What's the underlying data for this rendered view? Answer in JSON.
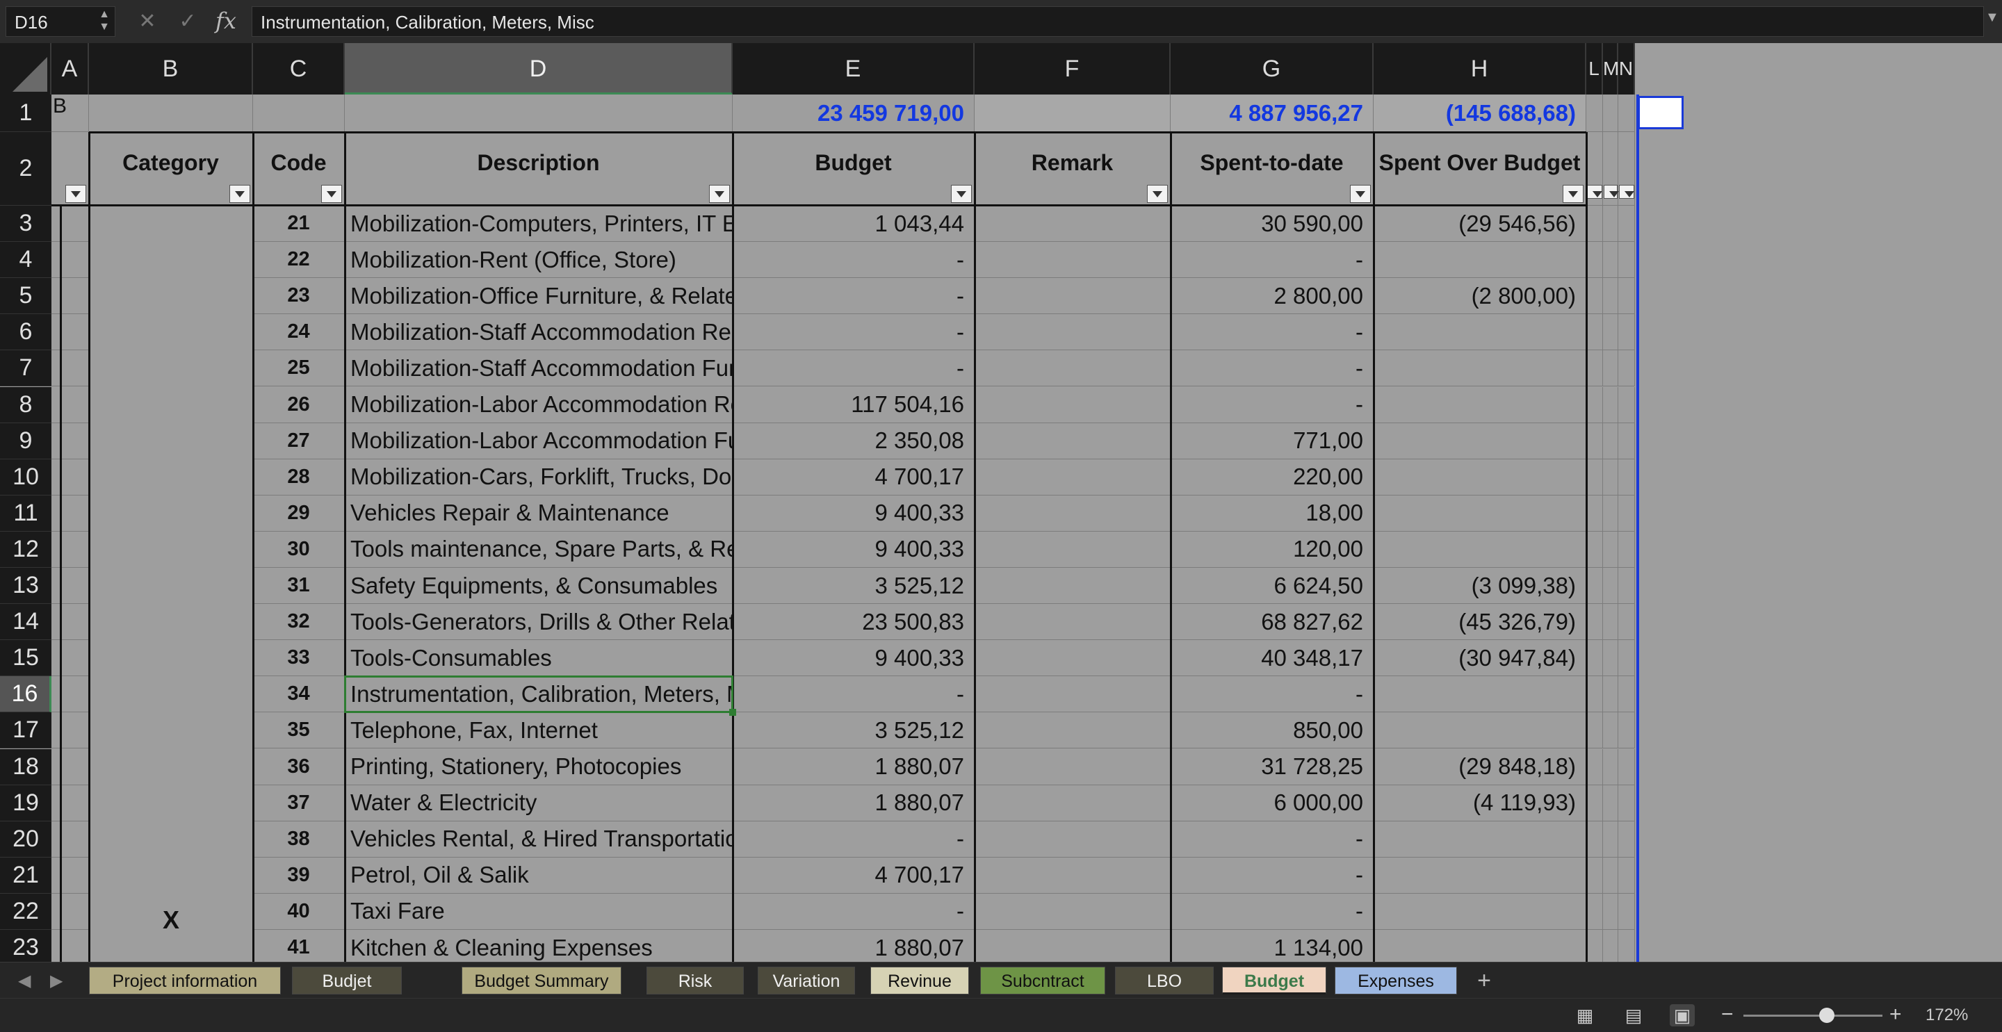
{
  "formula_bar": {
    "cell_ref": "D16",
    "cancel_icon": "✕",
    "confirm_icon": "✓",
    "fx_label": "fx",
    "content": "Instrumentation, Calibration, Meters, Misc"
  },
  "columns": [
    "A",
    "B",
    "C",
    "D",
    "E",
    "F",
    "G",
    "H",
    "L",
    "M",
    "N"
  ],
  "selected_column": "D",
  "selected_row": 16,
  "row1": {
    "a_text": "B",
    "budget_total": "23 459 719,00",
    "spent_total": "4 887 956,27",
    "over_total": "(145 688,68)"
  },
  "headers": {
    "category": "Category",
    "code": "Code",
    "description": "Description",
    "budget": "Budget",
    "remark": "Remark",
    "spent": "Spent-to-date",
    "over": "Spent Over Budget"
  },
  "category_marker": "X",
  "rows": [
    {
      "row": "3",
      "code": "21",
      "description": "Mobilization-Computers, Printers, IT Eqts, Photocopy Machine, Etc.",
      "budget": "1 043,44",
      "remark": "",
      "spent": "30 590,00",
      "over": "(29 546,56)"
    },
    {
      "row": "4",
      "code": "22",
      "description": "Mobilization-Rent (Office, Store)",
      "budget": "-",
      "remark": "",
      "spent": "-",
      "over": ""
    },
    {
      "row": "5",
      "code": "23",
      "description": "Mobilization-Office Furniture, & Related Items",
      "budget": "-",
      "remark": "",
      "spent": "2 800,00",
      "over": "(2 800,00)"
    },
    {
      "row": "6",
      "code": "24",
      "description": "Mobilization-Staff Accommodation Rent",
      "budget": "-",
      "remark": "",
      "spent": "-",
      "over": ""
    },
    {
      "row": "7",
      "code": "25",
      "description": "Mobilization-Staff Accommodation Furniture, & Related Items",
      "budget": "-",
      "remark": "",
      "spent": "-",
      "over": ""
    },
    {
      "row": "8",
      "code": "26",
      "description": "Mobilization-Labor Accommodation Rent",
      "budget": "117 504,16",
      "remark": "",
      "spent": "-",
      "over": ""
    },
    {
      "row": "9",
      "code": "27",
      "description": "Mobilization-Labor Accommodation Furniture, & Related Items",
      "budget": "2 350,08",
      "remark": "",
      "spent": "771,00",
      "over": ""
    },
    {
      "row": "10",
      "code": "28",
      "description": "Mobilization-Cars, Forklift, Trucks, Double Cabins, etc..",
      "budget": "4 700,17",
      "remark": "",
      "spent": "220,00",
      "over": ""
    },
    {
      "row": "11",
      "code": "29",
      "description": "Vehicles Repair & Maintenance",
      "budget": "9 400,33",
      "remark": "",
      "spent": "18,00",
      "over": ""
    },
    {
      "row": "12",
      "code": "30",
      "description": "Tools maintenance, Spare Parts, & Related Items",
      "budget": "9 400,33",
      "remark": "",
      "spent": "120,00",
      "over": ""
    },
    {
      "row": "13",
      "code": "31",
      "description": "Safety Equipments, & Consumables",
      "budget": "3 525,12",
      "remark": "",
      "spent": "6 624,50",
      "over": "(3 099,38)"
    },
    {
      "row": "14",
      "code": "32",
      "description": "Tools-Generators, Drills & Other Related Logistic Equipments",
      "budget": "23 500,83",
      "remark": "",
      "spent": "68 827,62",
      "over": "(45 326,79)"
    },
    {
      "row": "15",
      "code": "33",
      "description": "Tools-Consumables",
      "budget": "9 400,33",
      "remark": "",
      "spent": "40 348,17",
      "over": "(30 947,84)"
    },
    {
      "row": "16",
      "code": "34",
      "description": "Instrumentation, Calibration, Meters, Misc",
      "budget": "-",
      "remark": "",
      "spent": "-",
      "over": ""
    },
    {
      "row": "17",
      "code": "35",
      "description": "Telephone, Fax, Internet",
      "budget": "3 525,12",
      "remark": "",
      "spent": "850,00",
      "over": ""
    },
    {
      "row": "18",
      "code": "36",
      "description": "Printing, Stationery, Photocopies",
      "budget": "1 880,07",
      "remark": "",
      "spent": "31 728,25",
      "over": "(29 848,18)"
    },
    {
      "row": "19",
      "code": "37",
      "description": "Water & Electricity",
      "budget": "1 880,07",
      "remark": "",
      "spent": "6 000,00",
      "over": "(4 119,93)"
    },
    {
      "row": "20",
      "code": "38",
      "description": "Vehicles Rental, & Hired Transportation",
      "budget": "-",
      "remark": "",
      "spent": "-",
      "over": ""
    },
    {
      "row": "21",
      "code": "39",
      "description": "Petrol, Oil & Salik",
      "budget": "4 700,17",
      "remark": "",
      "spent": "-",
      "over": ""
    },
    {
      "row": "22",
      "code": "40",
      "description": "Taxi Fare",
      "budget": "-",
      "remark": "",
      "spent": "-",
      "over": ""
    },
    {
      "row": "23",
      "code": "41",
      "description": "Kitchen & Cleaning Expenses",
      "budget": "1 880,07",
      "remark": "",
      "spent": "1 134,00",
      "over": ""
    }
  ],
  "sheet_tabs": [
    {
      "label": "Project information",
      "color": "#b3ac84",
      "active": false
    },
    {
      "label": "Budjet variation",
      "color": "#4c4a3c",
      "active": false
    },
    {
      "label": "Budget Summary",
      "color": "#b0aa80",
      "active": false
    },
    {
      "label": "Risk",
      "color": "#4c4a3c",
      "active": false
    },
    {
      "label": "Variation",
      "color": "#4c4a3c",
      "active": false
    },
    {
      "label": "Revinue",
      "color": "#d6d2b4",
      "active": false
    },
    {
      "label": "Subcntract",
      "color": "#6e9446",
      "active": false
    },
    {
      "label": "LBO",
      "color": "#4c4a3c",
      "active": false
    },
    {
      "label": "Budget",
      "color": "#f0d4c0",
      "active": true
    },
    {
      "label": "Expenses",
      "color": "#9db8e2",
      "active": false
    }
  ],
  "add_sheet_label": "+",
  "status": {
    "zoom_minus": "−",
    "zoom_plus": "+",
    "zoom_level": "172%",
    "zoom_fraction": 0.6
  }
}
